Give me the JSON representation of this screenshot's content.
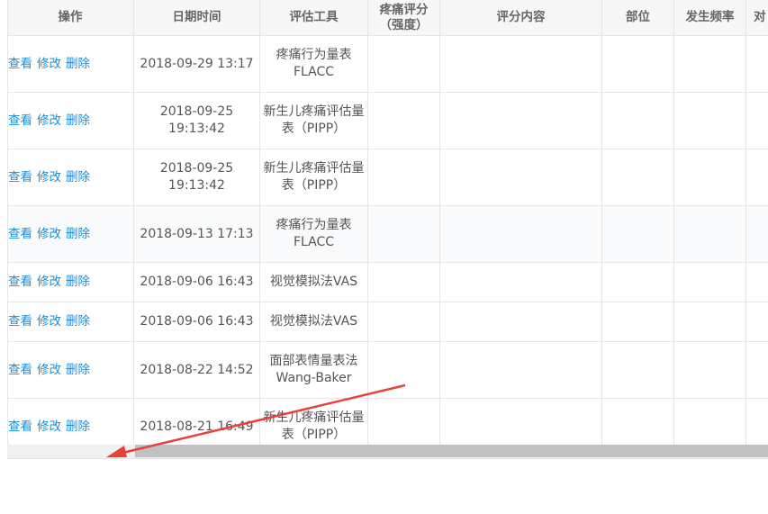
{
  "table": {
    "headers": {
      "ops": "操作",
      "datetime": "日期时间",
      "tool": "评估工具",
      "score_l1": "疼痛评分",
      "score_l2": "（强度）",
      "content": "评分内容",
      "site": "部位",
      "frequency": "发生频率",
      "partial": "对"
    },
    "action_labels": {
      "view": "查看",
      "edit": "修改",
      "delete": "删除"
    },
    "rows": [
      {
        "datetime": "2018-09-29 13:17",
        "tool_l1": "疼痛行为量表",
        "tool_l2": "FLACC"
      },
      {
        "datetime": "2018-09-25 19:13:42",
        "tool_l1": "新生儿疼痛评估量",
        "tool_l2": "表（PIPP）"
      },
      {
        "datetime": "2018-09-25 19:13:42",
        "tool_l1": "新生儿疼痛评估量",
        "tool_l2": "表（PIPP）"
      },
      {
        "datetime": "2018-09-13 17:13",
        "tool_l1": "疼痛行为量表",
        "tool_l2": "FLACC"
      },
      {
        "datetime": "2018-09-06 16:43",
        "tool_l1": "视觉模拟法VAS",
        "tool_l2": ""
      },
      {
        "datetime": "2018-09-06 16:43",
        "tool_l1": "视觉模拟法VAS",
        "tool_l2": ""
      },
      {
        "datetime": "2018-08-22 14:52",
        "tool_l1": "面部表情量表法",
        "tool_l2": "Wang-Baker"
      },
      {
        "datetime": "2018-08-21 16:49",
        "tool_l1": "新生儿疼痛评估量",
        "tool_l2": "表（PIPP）"
      }
    ]
  },
  "scrollbar": {
    "position": 0.17
  },
  "annotation": {
    "arrow_color": "#e8413c"
  }
}
